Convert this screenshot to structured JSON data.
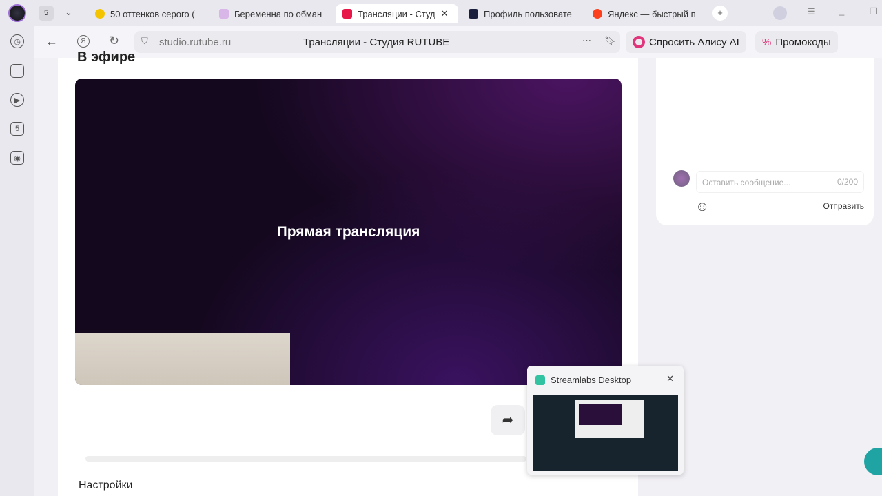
{
  "browser": {
    "tab_count": "5",
    "tabs": [
      {
        "title": "50 оттенков серого (",
        "color": "#f5c400"
      },
      {
        "title": "Беременна по обман",
        "color": "#9b59b6"
      },
      {
        "title": "Трансляции - Студ",
        "color": "#e8174a",
        "active": true
      },
      {
        "title": "Профиль пользовате",
        "color": "#1a1f3d"
      },
      {
        "title": "Яндекс — быстрый п",
        "color": "#fc3f1d"
      }
    ],
    "url": "studio.rutube.ru",
    "page_title": "Трансляции - Студия RUTUBE",
    "alice_label": "Спросить Алису AI",
    "promo_label": "Промокоды"
  },
  "sidebar": {
    "counter": "5"
  },
  "page": {
    "section_heading": "В эфире",
    "player_text": "Прямая трансляция",
    "bottom_heading": "Настройки"
  },
  "chat": {
    "placeholder": "Оставить сообщение...",
    "counter": "0/200",
    "send_label": "Отправить"
  },
  "taskbar_preview": {
    "title": "Streamlabs Desktop"
  }
}
